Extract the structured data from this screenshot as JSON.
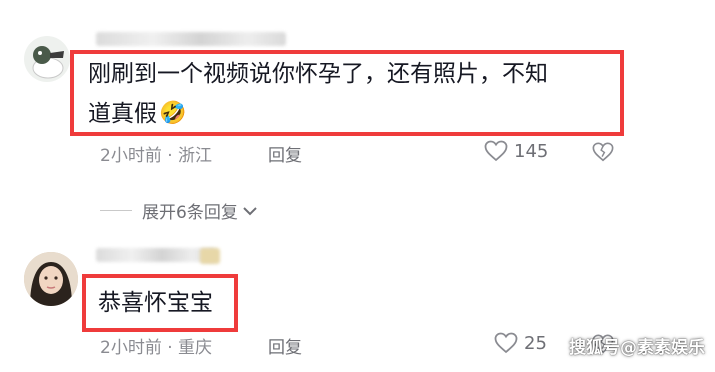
{
  "comments": [
    {
      "text_line1": "刚刷到一个视频说你怀孕了，还有照片，不知",
      "text_line2": "道真假",
      "emoji": "🤣",
      "time_location": "2小时前 · 浙江",
      "reply_label": "回复",
      "like_count": "145"
    },
    {
      "text": "恭喜怀宝宝",
      "time_location": "2小时前 · 重庆",
      "reply_label": "回复",
      "like_count": "25"
    }
  ],
  "expand_replies": "展开6条回复",
  "watermark": "搜狐号@素素娱乐",
  "colors": {
    "highlight_border": "#ef3b3b",
    "meta_text": "#8a8b91"
  },
  "icons": [
    "duck-avatar",
    "heart-outline-icon",
    "broken-heart-icon",
    "chevron-down-icon",
    "user-avatar"
  ]
}
